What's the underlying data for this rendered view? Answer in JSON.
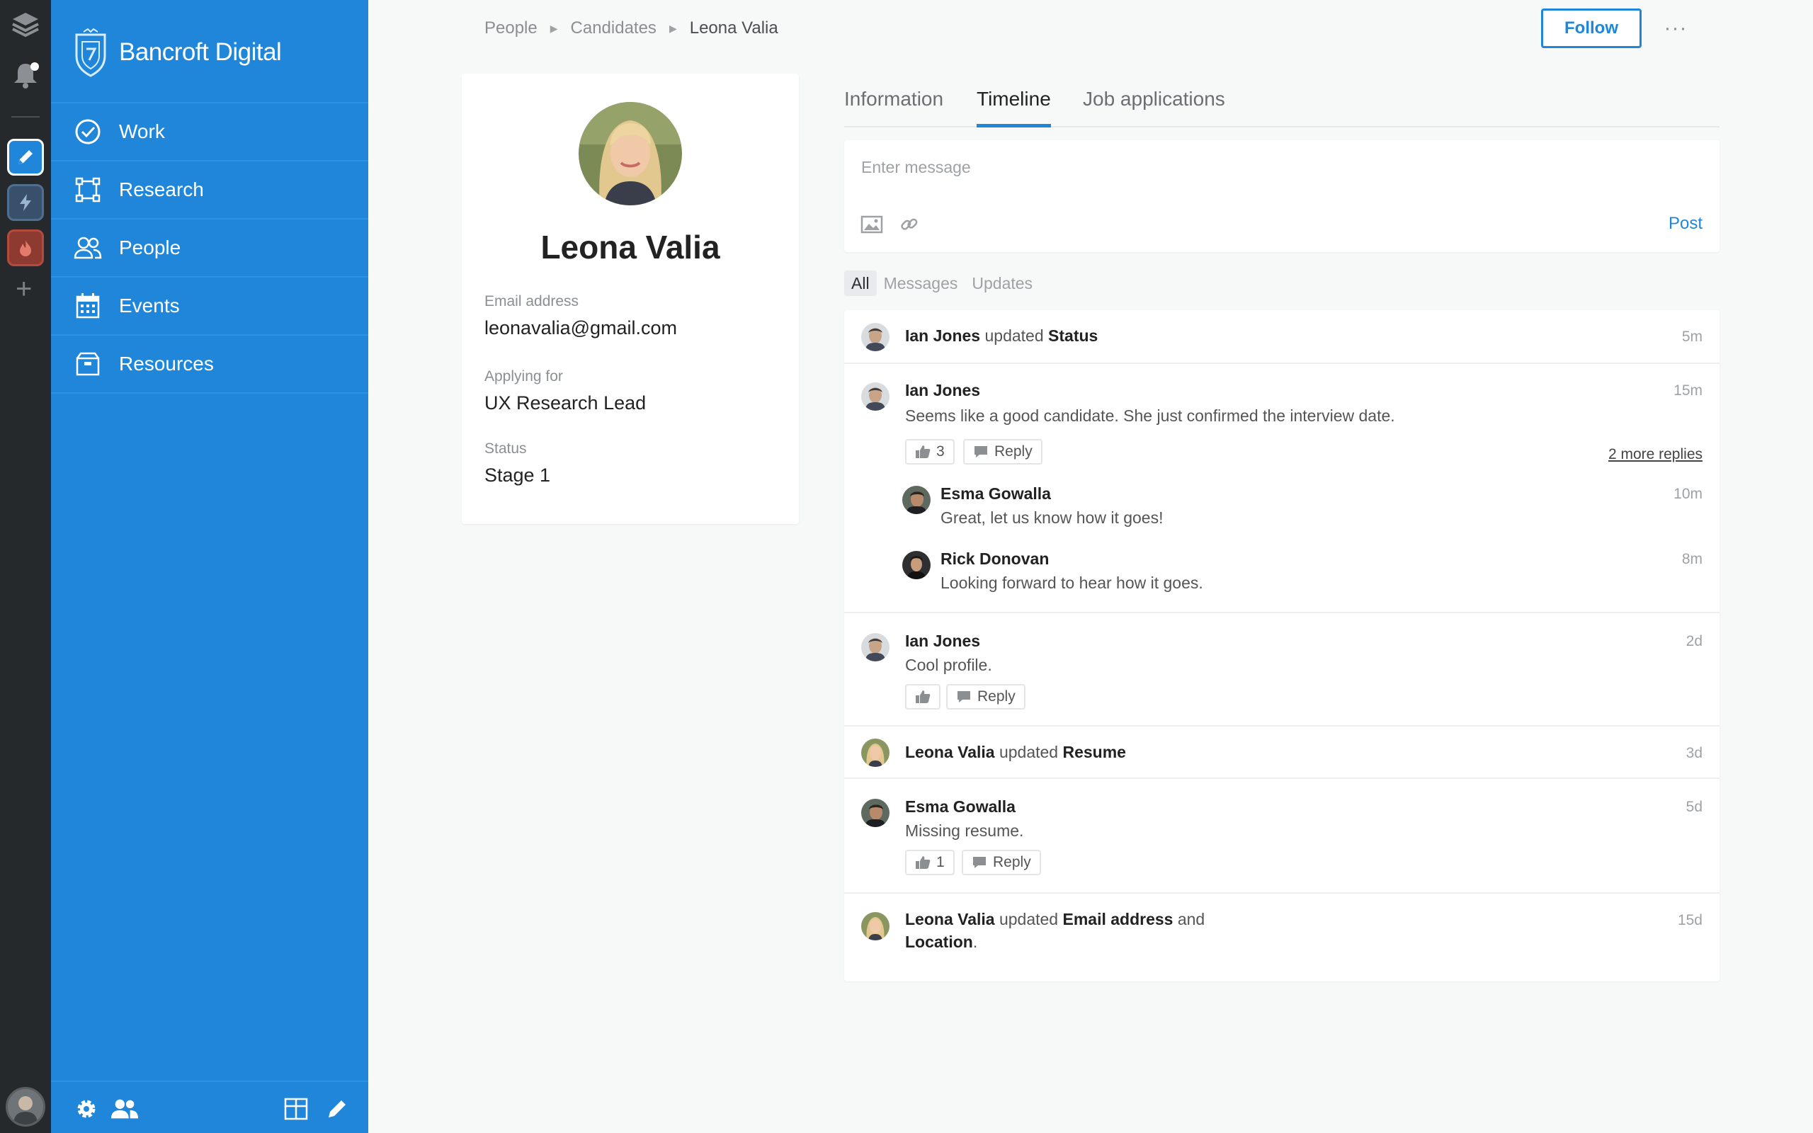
{
  "app": {
    "brand_name": "Bancroft Digital",
    "accent_color": "#1f86da",
    "rail_color": "#26292b"
  },
  "rail": {
    "icons": [
      "layers-icon",
      "bell-icon",
      "edit-app-icon",
      "bolt-app-icon",
      "fire-app-icon",
      "plus-icon",
      "user-avatar"
    ]
  },
  "sidebar": {
    "items": [
      {
        "label": "Work",
        "icon": "check-circle-icon"
      },
      {
        "label": "Research",
        "icon": "research-frame-icon"
      },
      {
        "label": "People",
        "icon": "people-icon"
      },
      {
        "label": "Events",
        "icon": "calendar-icon"
      },
      {
        "label": "Resources",
        "icon": "box-icon"
      }
    ],
    "footer_icons": [
      "gear-icon",
      "team-icon",
      "grid-icon",
      "pencil-icon"
    ]
  },
  "breadcrumb": {
    "items": [
      "People",
      "Candidates",
      "Leona Valia"
    ]
  },
  "header": {
    "follow_label": "Follow",
    "more_label": "···"
  },
  "profile": {
    "name": "Leona Valia",
    "email_label": "Email address",
    "email": "leonavalia@gmail.com",
    "applying_label": "Applying for",
    "applying": "UX Research Lead",
    "status_label": "Status",
    "status": "Stage 1"
  },
  "tabs": [
    "Information",
    "Timeline",
    "Job applications"
  ],
  "active_tab": "Timeline",
  "composer": {
    "placeholder": "Enter message",
    "post_label": "Post"
  },
  "filters": [
    "All",
    "Messages",
    "Updates"
  ],
  "active_filter": "All",
  "feed": {
    "e1": {
      "actor": "Ian Jones",
      "verb": "updated",
      "object": "Status",
      "time": "5m"
    },
    "e2": {
      "author": "Ian Jones",
      "text": "Seems like a good candidate. She just confirmed the interview date.",
      "time": "15m",
      "likes": "3",
      "reply_label": "Reply",
      "more_replies": "2 more replies",
      "replies": [
        {
          "author": "Esma Gowalla",
          "text": "Great, let us know how it goes!",
          "time": "10m"
        },
        {
          "author": "Rick Donovan",
          "text": "Looking forward to hear how it goes.",
          "time": "8m"
        }
      ]
    },
    "e3": {
      "author": "Ian Jones",
      "text": "Cool profile.",
      "time": "2d",
      "reply_label": "Reply"
    },
    "e4": {
      "actor": "Leona Valia",
      "verb": "updated",
      "object": "Resume",
      "time": "3d"
    },
    "e5": {
      "author": "Esma Gowalla",
      "text": "Missing resume.",
      "time": "5d",
      "likes": "1",
      "reply_label": "Reply"
    },
    "e6": {
      "actor": "Leona Valia",
      "verb": "updated",
      "object": "Email address",
      "conj": "and",
      "object2": "Location",
      "end": ".",
      "time": "15d"
    }
  }
}
